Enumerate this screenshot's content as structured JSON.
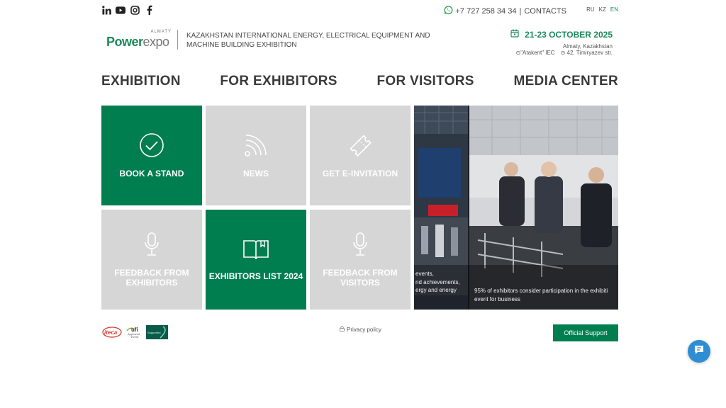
{
  "social": {
    "icons": [
      "linkedin-icon",
      "youtube-icon",
      "instagram-icon",
      "facebook-icon"
    ]
  },
  "contact": {
    "phone": "+7 727 258 34 34",
    "separator": "|",
    "contacts_label": "CONTACTS"
  },
  "languages": {
    "items": [
      "RU",
      "KZ",
      "EN"
    ],
    "active": "EN"
  },
  "brand": {
    "logo_city": "ALMATY",
    "logo_word_1": "Power",
    "logo_word_2": "expo",
    "description": "KAZAKHSTAN INTERNATIONAL ENERGY, ELECTRICAL EQUIPMENT AND MACHINE BUILDING EXHIBITION"
  },
  "event": {
    "dates": "21-23 OCTOBER 2025",
    "city": "Almaty, Kazakhstan",
    "venue": "\"Atakent\" IEC",
    "address": "42, Timiryazev str."
  },
  "nav": {
    "items": [
      "EXHIBITION",
      "FOR EXHIBITORS",
      "FOR VISITORS",
      "MEDIA CENTER"
    ]
  },
  "tiles": {
    "book_stand": "BOOK A STAND",
    "news": "NEWS",
    "e_invitation": "GET E-INVITATION",
    "feedback_exhibitors": "FEEDBACK FROM EXHIBITORS",
    "exhibitors_list": "EXHIBITORS LIST 2024",
    "feedback_visitors": "FEEDBACK FROM VISITORS"
  },
  "slider": {
    "caption_left_1": "events,",
    "caption_left_2": "nd achievements,",
    "caption_left_3": "ergy and energy",
    "caption_right_1": "95% of exhibitors consider participation in the exhibiti",
    "caption_right_2": "event for business"
  },
  "footer": {
    "partner_ite": "iteca",
    "partner_ufi_1": "ufi",
    "partner_ufi_2": "Approved",
    "partner_ufi_3": "Event",
    "partner_green": "Supported",
    "privacy": "Privacy policy",
    "support": "Official Support"
  },
  "colors": {
    "brand_green": "#017e4f",
    "tile_grey": "#d6d6d6",
    "chat_blue": "#2f8dd3"
  }
}
